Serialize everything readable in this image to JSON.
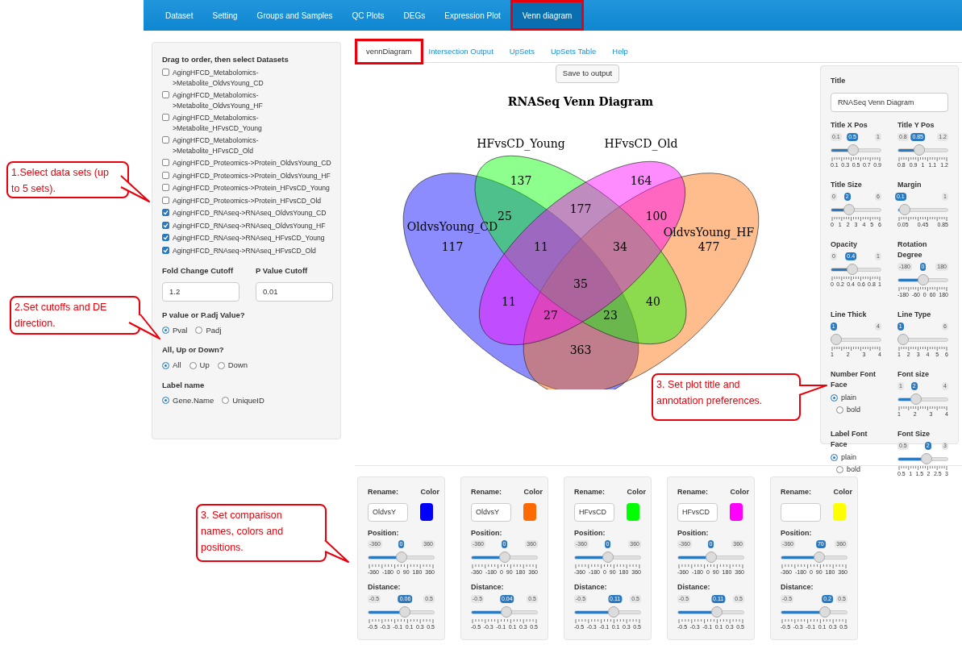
{
  "nav": {
    "items": [
      {
        "label": "Dataset",
        "selected": false,
        "highlighted": false
      },
      {
        "label": "Setting",
        "selected": false,
        "highlighted": false
      },
      {
        "label": "Groups and Samples",
        "selected": false,
        "highlighted": false
      },
      {
        "label": "QC Plots",
        "selected": false,
        "highlighted": false
      },
      {
        "label": "DEGs",
        "selected": false,
        "highlighted": false
      },
      {
        "label": "Expression Plot",
        "selected": false,
        "highlighted": false
      },
      {
        "label": "Venn diagram",
        "selected": true,
        "highlighted": true
      }
    ]
  },
  "datasets_panel": {
    "title": "Drag to order, then select Datasets",
    "items": [
      {
        "label": "AgingHFCD_Metabolomics->Metabolite_OldvsYoung_CD",
        "checked": false
      },
      {
        "label": "AgingHFCD_Metabolomics->Metabolite_OldvsYoung_HF",
        "checked": false
      },
      {
        "label": "AgingHFCD_Metabolomics->Metabolite_HFvsCD_Young",
        "checked": false
      },
      {
        "label": "AgingHFCD_Metabolomics->Metabolite_HFvsCD_Old",
        "checked": false
      },
      {
        "label": "AgingHFCD_Proteomics->Protein_OldvsYoung_CD",
        "checked": false
      },
      {
        "label": "AgingHFCD_Proteomics->Protein_OldvsYoung_HF",
        "checked": false
      },
      {
        "label": "AgingHFCD_Proteomics->Protein_HFvsCD_Young",
        "checked": false
      },
      {
        "label": "AgingHFCD_Proteomics->Protein_HFvsCD_Old",
        "checked": false
      },
      {
        "label": "AgingHFCD_RNAseq->RNAseq_OldvsYoung_CD",
        "checked": true
      },
      {
        "label": "AgingHFCD_RNAseq->RNAseq_OldvsYoung_HF",
        "checked": true
      },
      {
        "label": "AgingHFCD_RNAseq->RNAseq_HFvsCD_Young",
        "checked": true
      },
      {
        "label": "AgingHFCD_RNAseq->RNAseq_HFvsCD_Old",
        "checked": true
      }
    ],
    "fields": [
      {
        "label": "Fold Change Cutoff",
        "value": "1.2"
      },
      {
        "label": "P Value Cutoff",
        "value": "0.01"
      }
    ],
    "radio_groups": [
      {
        "label": "P value or P.adj Value?",
        "options": [
          {
            "label": "Pval",
            "selected": true
          },
          {
            "label": "Padj",
            "selected": false
          }
        ]
      },
      {
        "label": "All, Up or Down?",
        "options": [
          {
            "label": "All",
            "selected": true
          },
          {
            "label": "Up",
            "selected": false
          },
          {
            "label": "Down",
            "selected": false
          }
        ]
      },
      {
        "label": "Label name",
        "options": [
          {
            "label": "Gene.Name",
            "selected": true
          },
          {
            "label": "UniqueID",
            "selected": false
          }
        ]
      }
    ]
  },
  "tabs": [
    {
      "label": "vennDiagram",
      "selected": true,
      "highlighted": true
    },
    {
      "label": "Intersection Output",
      "selected": false,
      "highlighted": false
    },
    {
      "label": "UpSets",
      "selected": false,
      "highlighted": false
    },
    {
      "label": "UpSets Table",
      "selected": false,
      "highlighted": false
    },
    {
      "label": "Help",
      "selected": false,
      "highlighted": false
    }
  ],
  "save_button": "Save to output",
  "venn": {
    "title": "RNASeq Venn Diagram",
    "sets": [
      {
        "label": "OldvsYoung_CD"
      },
      {
        "label": "OldvsYoung_HF"
      },
      {
        "label": "HFvsCD_Young"
      },
      {
        "label": "HFvsCD_Old"
      }
    ],
    "counts": [
      "137",
      "164",
      "25",
      "177",
      "100",
      "117",
      "11",
      "34",
      "477",
      "35",
      "11",
      "40",
      "27",
      "23",
      "363"
    ]
  },
  "plot_settings": {
    "title_field": {
      "label": "Title",
      "value": "RNASeq Venn Diagram"
    },
    "controls": [
      {
        "kind": "slider",
        "label": "Title X Pos",
        "min": "0.1",
        "max": "1",
        "value": "0.5",
        "level": 0.43,
        "ticks": [
          "0.1",
          "0.3",
          "0.5",
          "0.7",
          "0.9"
        ]
      },
      {
        "kind": "slider",
        "label": "Title Y Pos",
        "min": "0.8",
        "max": "1.2",
        "value": "0.85",
        "level": 0.4,
        "ticks": [
          "0.8",
          "0.9",
          "1",
          "1.1",
          "1.2"
        ]
      },
      {
        "kind": "slider",
        "label": "Title Size",
        "min": "0",
        "max": "6",
        "value": "2",
        "level": 0.33,
        "ticks": [
          "0",
          "1",
          "2",
          "3",
          "4",
          "5",
          "6"
        ]
      },
      {
        "kind": "slider",
        "label": "Margin",
        "max": "1",
        "value": "0.1",
        "level": 0.05,
        "ticks": [
          "0.05",
          "0.45",
          "0.85"
        ]
      },
      {
        "kind": "slider",
        "label": "Opacity",
        "min": "0",
        "max": "1",
        "value": "0.4",
        "level": 0.4,
        "ticks": [
          "0",
          "0.2",
          "0.4",
          "0.6",
          "0.8",
          "1"
        ]
      },
      {
        "kind": "slider",
        "label": "Rotation Degree",
        "min": "-180",
        "max": "180",
        "value": "0",
        "level": 0.5,
        "ticks": [
          "-180",
          "-60",
          "0",
          "60",
          "180"
        ]
      },
      {
        "kind": "slider",
        "label": "Line Thick",
        "max": "4",
        "value": "1",
        "level": 0,
        "ticks": [
          "1",
          "2",
          "3",
          "4"
        ]
      },
      {
        "kind": "slider",
        "label": "Line Type",
        "max": "6",
        "value": "1",
        "level": 0,
        "ticks": [
          "1",
          "2",
          "3",
          "4",
          "5",
          "6"
        ]
      },
      {
        "kind": "radio",
        "label": "Number Font Face",
        "options": [
          {
            "label": "plain",
            "selected": true
          },
          {
            "label": "bold",
            "selected": false
          }
        ]
      },
      {
        "kind": "slider",
        "label": "Font size",
        "min": "1",
        "max": "4",
        "value": "2",
        "level": 0.33,
        "ticks": [
          "1",
          "2",
          "3",
          "4"
        ]
      },
      {
        "kind": "radio",
        "label": "Label Font Face",
        "options": [
          {
            "label": "plain",
            "selected": true
          },
          {
            "label": "bold",
            "selected": false
          }
        ]
      },
      {
        "kind": "slider",
        "label": "Font Size",
        "min": "0.5",
        "max": "3",
        "value": "2",
        "level": 0.6,
        "ticks": [
          "0.5",
          "1",
          "1.5",
          "2",
          "2.5",
          "3"
        ]
      }
    ]
  },
  "comparison_cards": [
    {
      "rename_label": "Rename:",
      "rename_value": "OldvsY",
      "color_label": "Color",
      "color": "#0000ff",
      "position": {
        "label": "Position:",
        "min": "-360",
        "max": "360",
        "value": "0",
        "level": 0.5,
        "ticks": [
          "-360",
          "-180",
          "0",
          "90",
          "180",
          "360"
        ]
      },
      "distance": {
        "label": "Distance:",
        "min": "-0.5",
        "max": "0.5",
        "value": "0.06",
        "level": 0.56,
        "ticks": [
          "-0.5",
          "-0.3",
          "-0.1",
          "0.1",
          "0.3",
          "0.5"
        ]
      }
    },
    {
      "rename_label": "Rename:",
      "rename_value": "OldvsY",
      "color_label": "Color",
      "color": "#ff6a00",
      "position": {
        "label": "Position:",
        "min": "-360",
        "max": "360",
        "value": "0",
        "level": 0.5,
        "ticks": [
          "-360",
          "-180",
          "0",
          "90",
          "180",
          "360"
        ]
      },
      "distance": {
        "label": "Distance:",
        "min": "-0.5",
        "max": "0.5",
        "value": "0.04",
        "level": 0.54,
        "ticks": [
          "-0.5",
          "-0.3",
          "-0.1",
          "0.1",
          "0.3",
          "0.5"
        ]
      }
    },
    {
      "rename_label": "Rename:",
      "rename_value": "HFvsCD",
      "color_label": "Color",
      "color": "#00ff00",
      "position": {
        "label": "Position:",
        "min": "-360",
        "max": "360",
        "value": "0",
        "level": 0.5,
        "ticks": [
          "-360",
          "-180",
          "0",
          "90",
          "180",
          "360"
        ]
      },
      "distance": {
        "label": "Distance:",
        "min": "-0.5",
        "max": "0.5",
        "value": "0.11",
        "level": 0.61,
        "ticks": [
          "-0.5",
          "-0.3",
          "-0.1",
          "0.1",
          "0.3",
          "0.5"
        ]
      }
    },
    {
      "rename_label": "Rename:",
      "rename_value": "HFvsCD",
      "color_label": "Color",
      "color": "#ff00ff",
      "position": {
        "label": "Position:",
        "min": "-360",
        "max": "360",
        "value": "0",
        "level": 0.5,
        "ticks": [
          "-360",
          "-180",
          "0",
          "90",
          "180",
          "360"
        ]
      },
      "distance": {
        "label": "Distance:",
        "min": "-0.5",
        "max": "0.5",
        "value": "0.11",
        "level": 0.61,
        "ticks": [
          "-0.5",
          "-0.3",
          "-0.1",
          "0.1",
          "0.3",
          "0.5"
        ]
      }
    },
    {
      "rename_label": "Rename:",
      "color_label": "Color",
      "color": "#ffff00",
      "position": {
        "label": "Position:",
        "min": "-360",
        "max": "360",
        "value": "70",
        "level": 0.6,
        "ticks": [
          "-360",
          "-180",
          "0",
          "90",
          "180",
          "360"
        ]
      },
      "distance": {
        "label": "Distance:",
        "min": "-0.5",
        "max": "0.5",
        "value": "0.2",
        "level": 0.7,
        "ticks": [
          "-0.5",
          "-0.3",
          "-0.1",
          "0.1",
          "0.3",
          "0.5"
        ]
      }
    }
  ],
  "callouts": [
    "1.Select data sets (up to 5 sets).",
    "2.Set cutoffs and DE direction.",
    "3. Set plot title and annotation preferences.",
    "3. Set comparison names, colors and positions."
  ]
}
